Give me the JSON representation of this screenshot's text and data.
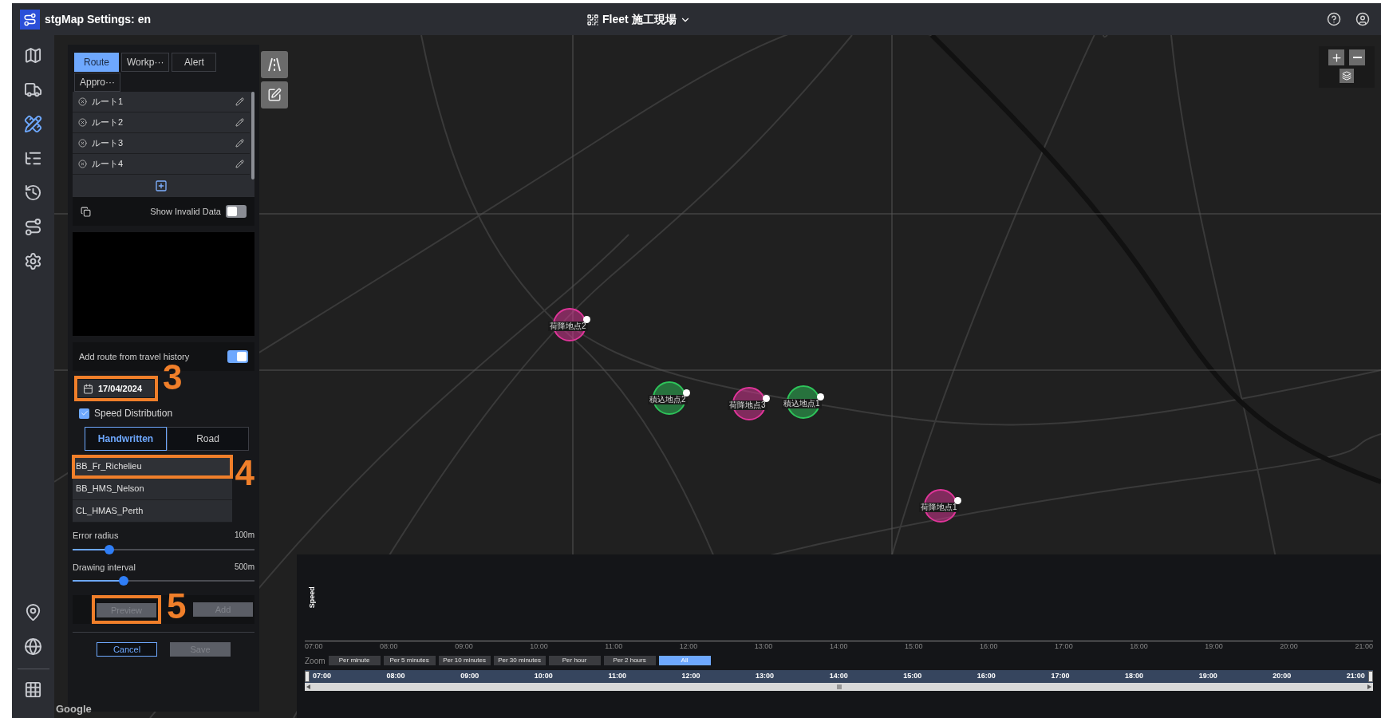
{
  "header": {
    "title": "stgMap Settings: en",
    "site": "Fleet 施工現場"
  },
  "sidebar": {
    "items": [
      {
        "selected": false
      },
      {
        "selected": false
      },
      {
        "selected": true
      },
      {
        "selected": false
      },
      {
        "selected": false
      },
      {
        "selected": false
      },
      {
        "selected": false
      }
    ],
    "bottom_items": [
      {
        "selected": false
      },
      {
        "selected": false
      },
      {
        "selected": false
      }
    ]
  },
  "panel": {
    "tabs": [
      {
        "label": "Route",
        "selected": true
      },
      {
        "label": "Workp···",
        "selected": false
      },
      {
        "label": "Alert",
        "selected": false
      },
      {
        "label": "Appro···",
        "selected": false
      }
    ],
    "routes": [
      {
        "name": "ルート1"
      },
      {
        "name": "ルート2"
      },
      {
        "name": "ルート3"
      },
      {
        "name": "ルート4"
      }
    ],
    "show_invalid_data": {
      "label": "Show Invalid Data",
      "on": false
    },
    "travel_history": {
      "label": "Add route from travel history",
      "on": true
    },
    "date": "17/04/2024",
    "speed_distribution": {
      "label": "Speed Distribution",
      "checked": true
    },
    "modes": [
      {
        "label": "Handwritten",
        "selected": true
      },
      {
        "label": "Road",
        "selected": false
      }
    ],
    "vessels": [
      {
        "name": "BB_Fr_Richelieu",
        "selected": true
      },
      {
        "name": "BB_HMS_Nelson",
        "selected": false
      },
      {
        "name": "CL_HMAS_Perth",
        "selected": false
      }
    ],
    "sliders": [
      {
        "label": "Error radius",
        "reading": "100m",
        "level": 0.2
      },
      {
        "label": "Drawing interval",
        "reading": "500m",
        "level": 0.28
      }
    ],
    "actions": [
      {
        "label": "Preview",
        "disabled": true
      },
      {
        "label": "Add",
        "disabled": true
      }
    ],
    "footer": [
      {
        "label": "Cancel",
        "disabled": false
      },
      {
        "label": "Save",
        "disabled": true
      }
    ]
  },
  "annotations": [
    "3",
    "4",
    "5"
  ],
  "map": {
    "markers": [
      {
        "label": "荷降地点2",
        "color": "#e0359a"
      },
      {
        "label": "積込地点2",
        "color": "#2ec45a"
      },
      {
        "label": "荷降地点3",
        "color": "#e0359a"
      },
      {
        "label": "積込地点1",
        "color": "#2ec45a"
      },
      {
        "label": "荷降地点1",
        "color": "#e0359a"
      }
    ],
    "attribution": "Google"
  },
  "timeline": {
    "ylabel": "Speed",
    "ticks": [
      "07:00",
      "08:00",
      "09:00",
      "10:00",
      "11:00",
      "12:00",
      "13:00",
      "14:00",
      "15:00",
      "16:00",
      "17:00",
      "18:00",
      "19:00",
      "20:00",
      "21:00"
    ],
    "zoom_label": "Zoom",
    "zoom_options": [
      {
        "label": "Per minute",
        "selected": false
      },
      {
        "label": "Per 5 minutes",
        "selected": false
      },
      {
        "label": "Per 10 minutes",
        "selected": false
      },
      {
        "label": "Per 30 minutes",
        "selected": false
      },
      {
        "label": "Per hour",
        "selected": false
      },
      {
        "label": "Per 2 hours",
        "selected": false
      },
      {
        "label": "All",
        "selected": true
      }
    ],
    "navigator_ticks": [
      "07:00",
      "08:00",
      "09:00",
      "10:00",
      "11:00",
      "12:00",
      "13:00",
      "14:00",
      "15:00",
      "16:00",
      "17:00",
      "18:00",
      "19:00",
      "20:00",
      "21:00"
    ]
  }
}
